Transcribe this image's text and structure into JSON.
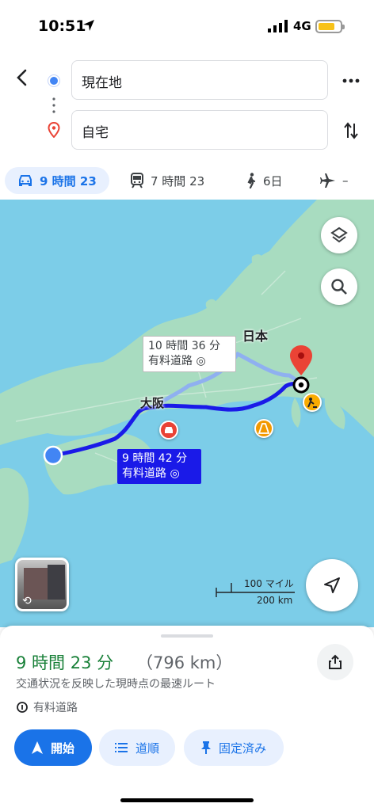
{
  "status_bar": {
    "time": "10:51",
    "network": "4G"
  },
  "header": {
    "origin": "現在地",
    "destination": "自宅"
  },
  "modes": {
    "drive": "9 時間 23",
    "transit": "7 時間 23",
    "walk": "6日",
    "flight": "–"
  },
  "map": {
    "labels": {
      "japan": "日本",
      "osaka": "大阪"
    },
    "alt_route": {
      "time": "10 時間 36 分",
      "toll": "有料道路"
    },
    "main_route": {
      "time": "9 時間 42 分",
      "toll": "有料道路"
    },
    "scale": {
      "miles": "100 マイル",
      "km": "200 km"
    },
    "colors": {
      "water": "#7ccde8",
      "land": "#a8dcc0",
      "route": "#1a1ae8",
      "alt_route": "#8fb0f0"
    }
  },
  "sheet": {
    "duration": "9 時間 23 分",
    "distance": "（796 km）",
    "description": "交通状況を反映した現時点の最速ルート",
    "toll": "有料道路",
    "buttons": {
      "start": "開始",
      "steps": "道順",
      "pinned": "固定済み"
    }
  }
}
